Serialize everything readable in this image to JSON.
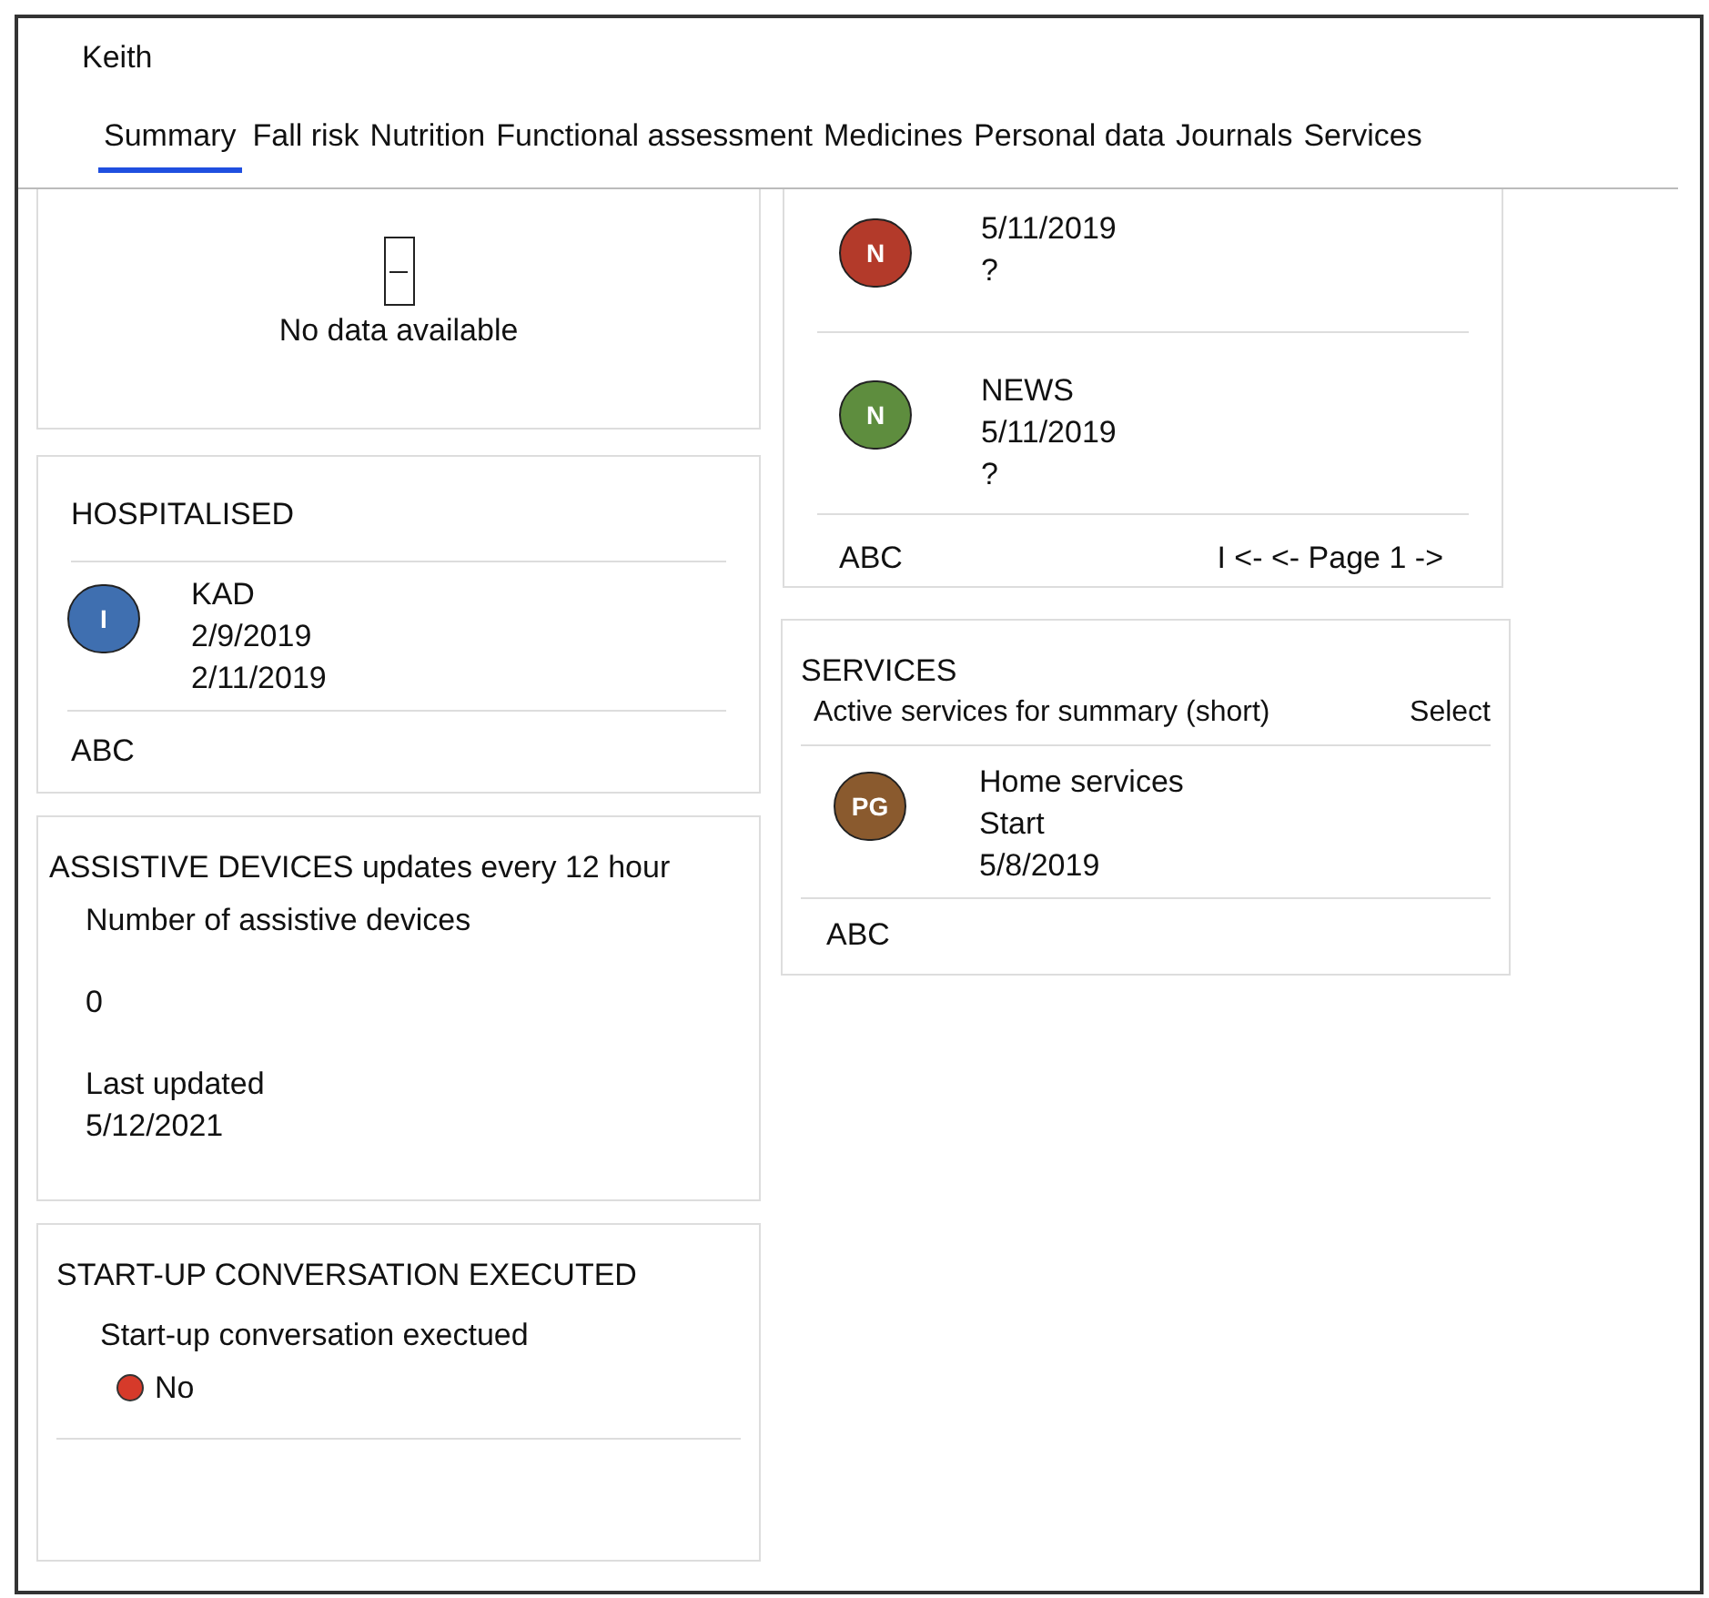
{
  "user": {
    "name": "Keith"
  },
  "tabs": [
    {
      "label": "Summary",
      "selected": true
    },
    {
      "label": "Fall risk",
      "selected": false
    },
    {
      "label": "Nutrition",
      "selected": false
    },
    {
      "label": "Functional assessment",
      "selected": false
    },
    {
      "label": "Medicines",
      "selected": false
    },
    {
      "label": "Personal data",
      "selected": false
    },
    {
      "label": "Journals",
      "selected": false
    },
    {
      "label": "Services",
      "selected": false
    }
  ],
  "no_data_card": {
    "message": "No data available"
  },
  "hospitalised": {
    "title": "HOSPITALISED",
    "entries": [
      {
        "initial": "I",
        "color": "#3f6fb0",
        "lines": [
          "KAD",
          "2/9/2019",
          "2/11/2019"
        ]
      }
    ],
    "footer": "ABC"
  },
  "assistive_devices": {
    "title": "ASSISTIVE DEVICES updates every 12 hour",
    "count_label": "Number of assistive devices",
    "count": "0",
    "updated_label": "Last updated",
    "updated": "5/12/2021"
  },
  "startup_conversation": {
    "title": "START-UP CONVERSATION EXECUTED",
    "label": "Start-up conversation exectued",
    "status": "No",
    "color": "#d63a2a"
  },
  "news": {
    "entries": [
      {
        "initial": "N",
        "color": "#b33a2a",
        "lines": [
          "5/11/2019",
          "?"
        ]
      },
      {
        "initial": "N",
        "color": "#5e8d3e",
        "lines": [
          "NEWS",
          "5/11/2019",
          "?"
        ]
      }
    ],
    "footer": "ABC",
    "pager": "I <- <- Page 1 ->"
  },
  "services": {
    "title": "SERVICES",
    "subtitle": "Active services for summary (short)",
    "action": "Select",
    "entries": [
      {
        "initial": "PG",
        "color": "#8a5a2e",
        "lines": [
          "Home services",
          "Start",
          "5/8/2019"
        ]
      }
    ],
    "footer": "ABC"
  }
}
